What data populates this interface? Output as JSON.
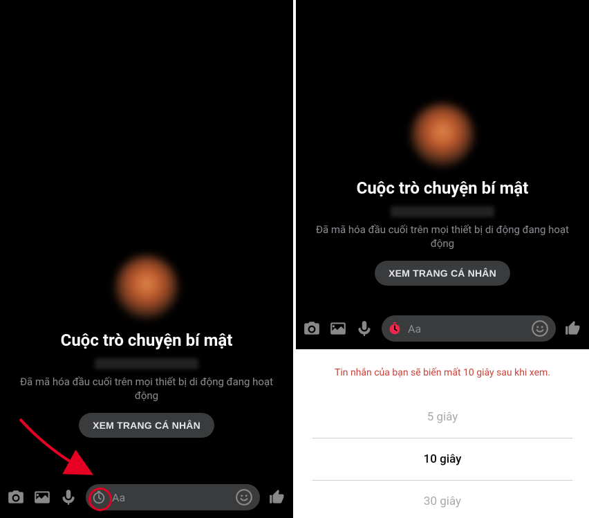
{
  "left": {
    "title": "Cuộc trò chuyện bí mật",
    "description": "Đã mã hóa đầu cuối trên mọi thiết bị di động đang hoạt động",
    "profile_button": "XEM TRANG CÁ NHÂN",
    "input_placeholder": "Aa"
  },
  "right": {
    "title": "Cuộc trò chuyện bí mật",
    "description": "Đã mã hóa đầu cuối trên mọi thiết bị di động đang hoạt động",
    "profile_button": "XEM TRANG CÁ NHÂN",
    "input_placeholder": "Aa",
    "warning_text": "Tin nhắn của bạn sẽ biến mất 10 giây sau khi xem.",
    "options": {
      "opt_5s": "5 giây",
      "opt_10s": "10 giây",
      "opt_30s": "30 giây"
    }
  }
}
